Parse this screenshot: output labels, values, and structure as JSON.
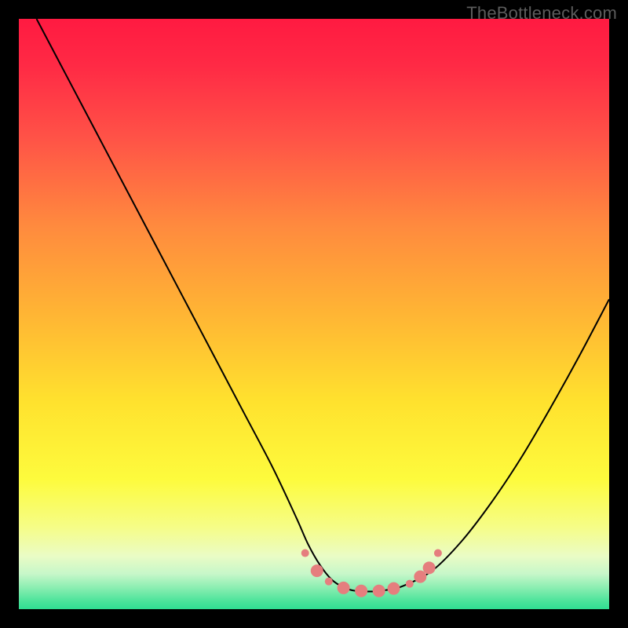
{
  "watermark": "TheBottleneck.com",
  "chart_data": {
    "type": "line",
    "title": "",
    "xlabel": "",
    "ylabel": "",
    "xlim": [
      0,
      100
    ],
    "ylim": [
      0,
      100
    ],
    "grid": false,
    "series": [
      {
        "name": "curve",
        "x": [
          3,
          8,
          13,
          18,
          23,
          28,
          33,
          38,
          43,
          47,
          49,
          51,
          53,
          55,
          57,
          60,
          62,
          65,
          70,
          75,
          80,
          85,
          90,
          95,
          100
        ],
        "y": [
          100,
          90.5,
          81,
          71.5,
          62,
          52.5,
          43,
          33.5,
          24,
          15.5,
          11,
          7.5,
          5,
          3.7,
          3.1,
          3,
          3.2,
          3.9,
          6.5,
          11.5,
          18,
          25.5,
          34,
          43,
          52.5
        ],
        "color": "#000000",
        "width": 2
      }
    ],
    "markers": {
      "name": "highlight-dots",
      "color": "#e57e7e",
      "radius_small": 5,
      "radius_large": 8,
      "points": [
        {
          "x": 48.5,
          "y": 9.5,
          "r": 5
        },
        {
          "x": 50.5,
          "y": 6.5,
          "r": 8
        },
        {
          "x": 52.5,
          "y": 4.7,
          "r": 5
        },
        {
          "x": 55,
          "y": 3.6,
          "r": 8
        },
        {
          "x": 58,
          "y": 3.1,
          "r": 8
        },
        {
          "x": 61,
          "y": 3.1,
          "r": 8
        },
        {
          "x": 63.5,
          "y": 3.5,
          "r": 8
        },
        {
          "x": 66.2,
          "y": 4.3,
          "r": 5
        },
        {
          "x": 68,
          "y": 5.5,
          "r": 8
        },
        {
          "x": 69.5,
          "y": 7,
          "r": 8
        },
        {
          "x": 71,
          "y": 9.5,
          "r": 5
        }
      ]
    },
    "background_gradient": {
      "stops": [
        {
          "offset": 0.0,
          "color": "#ff1a41"
        },
        {
          "offset": 0.08,
          "color": "#ff2a45"
        },
        {
          "offset": 0.2,
          "color": "#ff5247"
        },
        {
          "offset": 0.35,
          "color": "#ff8a3e"
        },
        {
          "offset": 0.5,
          "color": "#ffb534"
        },
        {
          "offset": 0.65,
          "color": "#ffe22e"
        },
        {
          "offset": 0.78,
          "color": "#fdfb3d"
        },
        {
          "offset": 0.86,
          "color": "#f6fd86"
        },
        {
          "offset": 0.91,
          "color": "#eafcc5"
        },
        {
          "offset": 0.94,
          "color": "#c7f7c9"
        },
        {
          "offset": 0.965,
          "color": "#87edb0"
        },
        {
          "offset": 0.985,
          "color": "#4fe49c"
        },
        {
          "offset": 1.0,
          "color": "#2fde92"
        }
      ]
    }
  }
}
